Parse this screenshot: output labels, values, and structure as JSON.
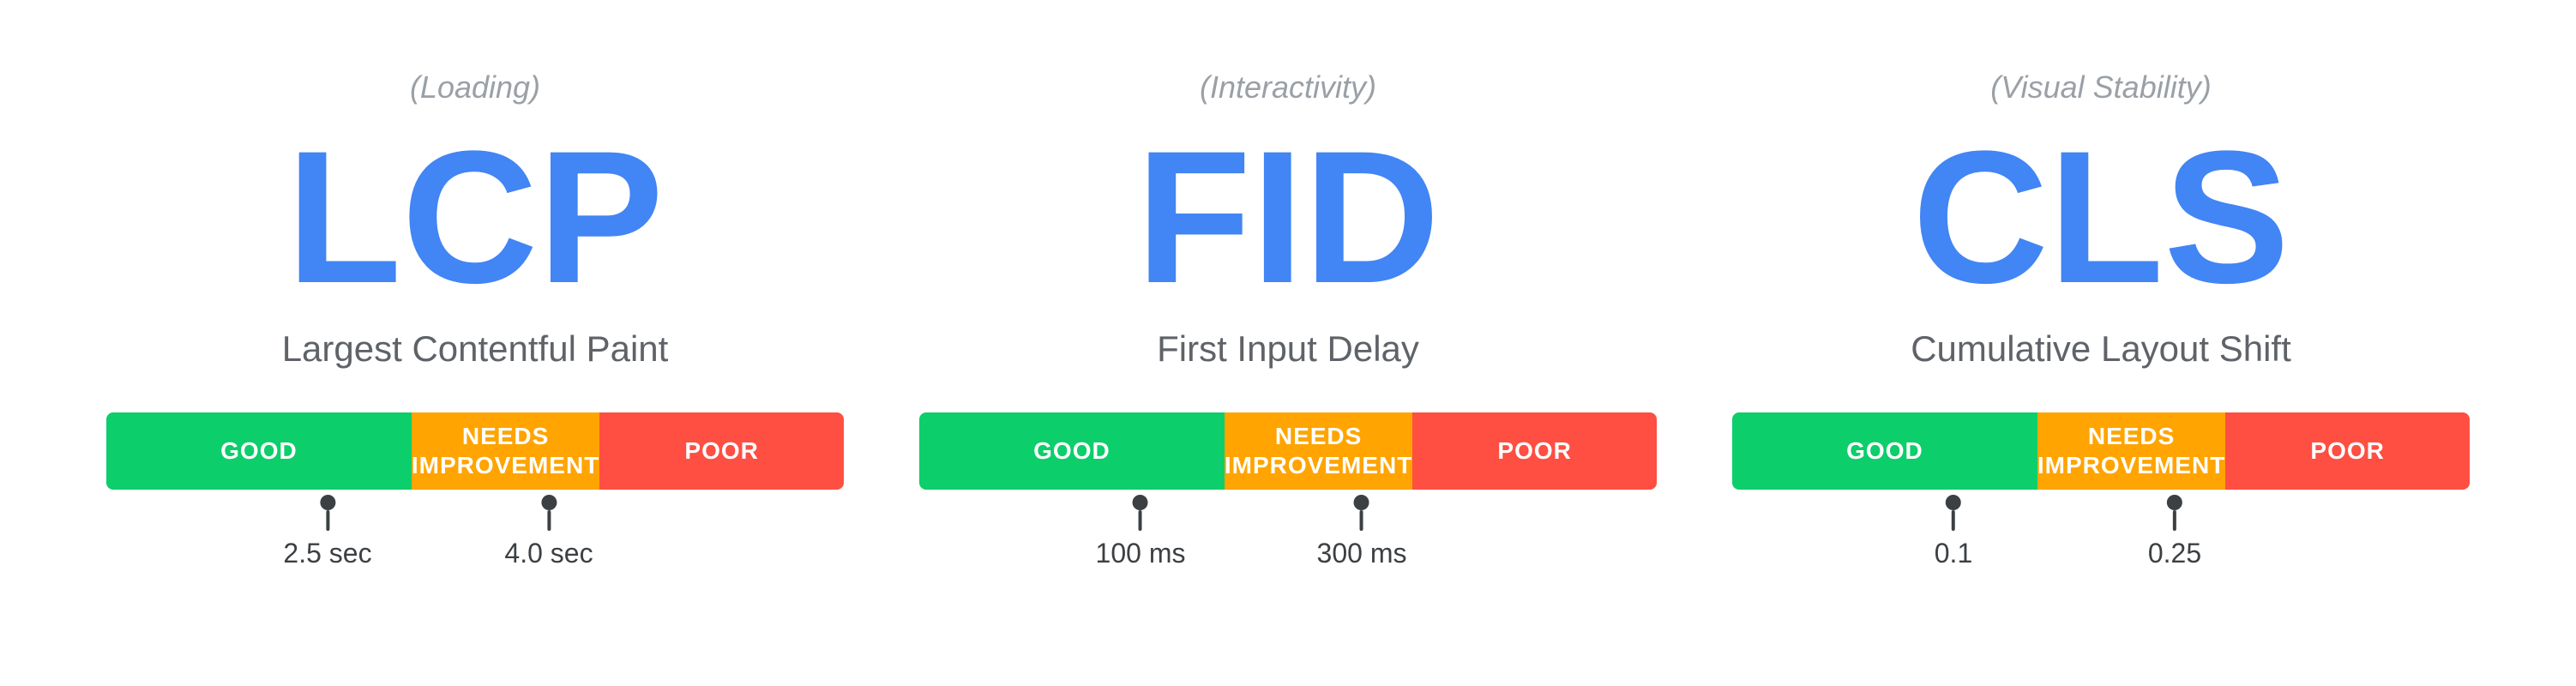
{
  "metrics": [
    {
      "id": "lcp",
      "category": "(Loading)",
      "abbr": "LCP",
      "name": "Largest Contentful Paint",
      "bar": {
        "good_label": "GOOD",
        "needs_label": "NEEDS\nIMPROVEMENT",
        "poor_label": "POOR"
      },
      "marker1_value": "2.5 sec",
      "marker2_value": "4.0 sec"
    },
    {
      "id": "fid",
      "category": "(Interactivity)",
      "abbr": "FID",
      "name": "First Input Delay",
      "bar": {
        "good_label": "GOOD",
        "needs_label": "NEEDS\nIMPROVEMENT",
        "poor_label": "POOR"
      },
      "marker1_value": "100 ms",
      "marker2_value": "300 ms"
    },
    {
      "id": "cls",
      "category": "(Visual Stability)",
      "abbr": "CLS",
      "name": "Cumulative Layout Shift",
      "bar": {
        "good_label": "GOOD",
        "needs_label": "NEEDS\nIMPROVEMENT",
        "poor_label": "POOR"
      },
      "marker1_value": "0.1",
      "marker2_value": "0.25"
    }
  ]
}
